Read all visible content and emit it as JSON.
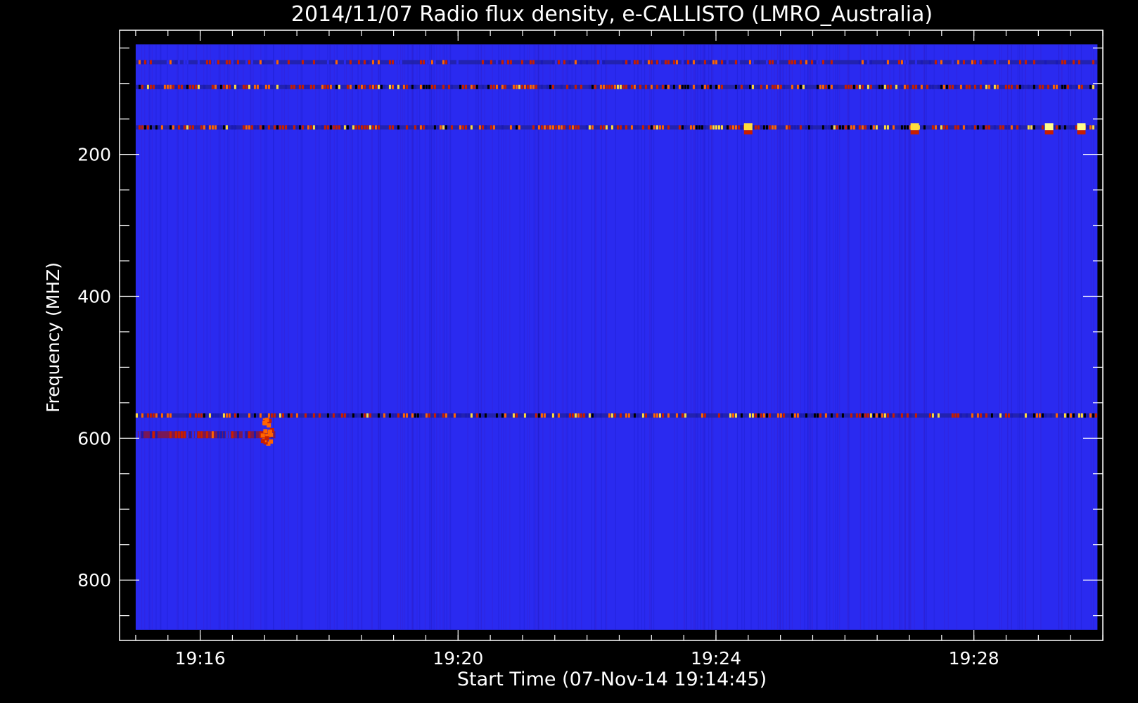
{
  "chart_data": {
    "type": "heatmap",
    "title": "2014/11/07  Radio flux density, e-CALLISTO (LMRO_Australia)",
    "xlabel": "Start Time (07-Nov-14 19:14:45)",
    "ylabel": "Frequency (MHZ)",
    "x_unit": "UT",
    "x_range": [
      "19:14:45",
      "19:30:00"
    ],
    "x_data_range": [
      "19:15:00",
      "19:29:55"
    ],
    "x_ticks": [
      "19:16",
      "19:20",
      "19:24",
      "19:28"
    ],
    "y_range": [
      885,
      25
    ],
    "y_data_range": [
      45,
      870
    ],
    "y_ticks": [
      200,
      400,
      600,
      800
    ],
    "y_inverted": true,
    "grid": false,
    "colormap": [
      "#000000",
      "#1a1ab4",
      "#2a2af0",
      "#c81e00",
      "#ff6400",
      "#ffdc3c",
      "#ffff8c"
    ],
    "background_color": "#2a2af0",
    "features": [
      {
        "kind": "interference-band",
        "frequency_mhz": 70,
        "t_start": "19:15:00",
        "t_end": "19:29:55",
        "intensity": "moderate"
      },
      {
        "kind": "interference-band",
        "frequency_mhz": 105,
        "t_start": "19:15:00",
        "t_end": "19:29:55",
        "intensity": "strong"
      },
      {
        "kind": "interference-band",
        "frequency_mhz": 162,
        "t_start": "19:15:00",
        "t_end": "19:29:55",
        "intensity": "strong"
      },
      {
        "kind": "interference-band",
        "frequency_mhz": 568,
        "t_start": "19:15:00",
        "t_end": "19:29:55",
        "intensity": "strong"
      },
      {
        "kind": "enhanced-band",
        "frequency_mhz": 595,
        "t_start": "19:15:00",
        "t_end": "19:17:10",
        "intensity": "moderate"
      },
      {
        "kind": "burst",
        "frequency_mhz": 580,
        "time": "19:17:00",
        "intensity": "strong"
      },
      {
        "kind": "spot",
        "frequency_mhz": 162,
        "time": "19:29:10",
        "intensity": "very-strong"
      },
      {
        "kind": "spot",
        "frequency_mhz": 162,
        "time": "19:29:40",
        "intensity": "very-strong"
      },
      {
        "kind": "spot",
        "frequency_mhz": 162,
        "time": "19:24:30",
        "intensity": "strong"
      },
      {
        "kind": "spot",
        "frequency_mhz": 162,
        "time": "19:27:05",
        "intensity": "strong"
      }
    ]
  }
}
